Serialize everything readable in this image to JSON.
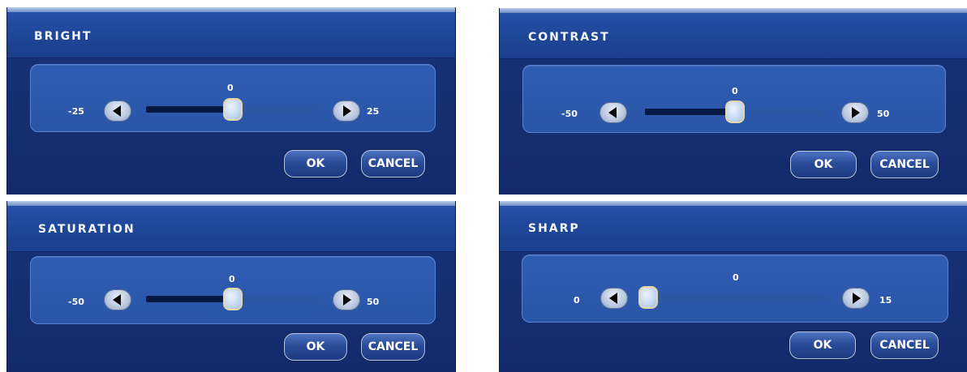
{
  "dialogs": [
    {
      "title": "BRIGHT",
      "min_label": "-25",
      "max_label": "25",
      "current": "0",
      "min": -25,
      "max": 25,
      "value": 0,
      "ok_label": "OK",
      "cancel_label": "CANCEL"
    },
    {
      "title": "CONTRAST",
      "min_label": "-50",
      "max_label": "50",
      "current": "0",
      "min": -50,
      "max": 50,
      "value": 0,
      "ok_label": "OK",
      "cancel_label": "CANCEL"
    },
    {
      "title": "SATURATION",
      "min_label": "-50",
      "max_label": "50",
      "current": "0",
      "min": -50,
      "max": 50,
      "value": 0,
      "ok_label": "OK",
      "cancel_label": "CANCEL"
    },
    {
      "title": "SHARP",
      "min_label": "0",
      "max_label": "15",
      "current": "0",
      "min": 0,
      "max": 15,
      "value": 0,
      "ok_label": "OK",
      "cancel_label": "CANCEL"
    }
  ],
  "icons": {
    "decrease": "left-triangle-icon",
    "increase": "right-triangle-icon"
  },
  "colors": {
    "background": "#17337a",
    "header": "#1e4697",
    "panel": "#2f5db3",
    "track_fill": "#071a45",
    "thumb_border": "#e6d7a8"
  }
}
